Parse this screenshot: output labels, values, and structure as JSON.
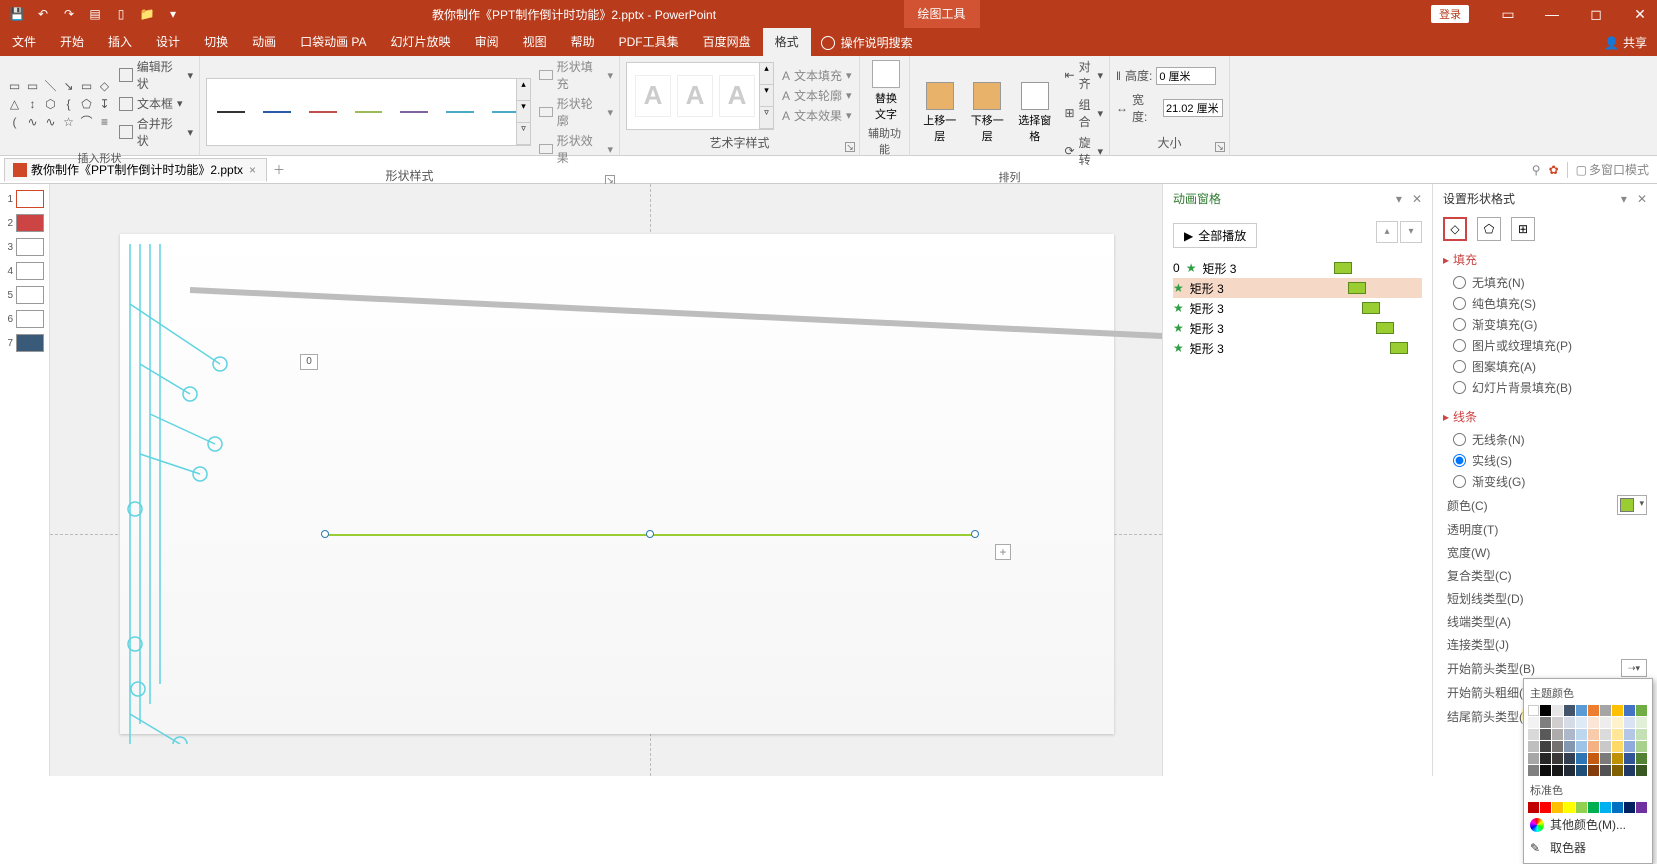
{
  "titlebar": {
    "doc_title": "教你制作《PPT制作倒计时功能》2.pptx - PowerPoint",
    "context_tab": "绘图工具",
    "login": "登录",
    "share": "共享"
  },
  "tabs": {
    "file": "文件",
    "home": "开始",
    "insert": "插入",
    "design": "设计",
    "transition": "切换",
    "animation": "动画",
    "pocket": "口袋动画 PA",
    "slideshow": "幻灯片放映",
    "review": "审阅",
    "view": "视图",
    "help": "帮助",
    "pdf": "PDF工具集",
    "baidu": "百度网盘",
    "format": "格式",
    "tell": "操作说明搜索"
  },
  "ribbon": {
    "insert_shapes": {
      "label": "插入形状",
      "edit_shape": "编辑形状",
      "text_box": "文本框",
      "merge_shape": "合并形状"
    },
    "shape_styles": {
      "label": "形状样式",
      "fill": "形状填充",
      "outline": "形状轮廓",
      "effects": "形状效果"
    },
    "wordart": {
      "label": "艺术字样式",
      "text_fill": "文本填充",
      "text_outline": "文本轮廓",
      "text_effects": "文本效果"
    },
    "accessibility": {
      "label": "辅助功能",
      "alt_text": "替换\n文字"
    },
    "arrange": {
      "label": "排列",
      "bring_forward": "上移一层",
      "send_backward": "下移一层",
      "selection_pane": "选择窗格",
      "align": "对齐",
      "group": "组合",
      "rotate": "旋转"
    },
    "size": {
      "label": "大小",
      "height": "高度:",
      "width": "宽度:",
      "h_val": "0 厘米",
      "w_val": "21.02 厘米"
    }
  },
  "doctab": {
    "name": "教你制作《PPT制作倒计时功能》2.pptx",
    "multiwin": "多窗口模式"
  },
  "canvas": {
    "counter": "0"
  },
  "anim_pane": {
    "title": "动画窗格",
    "play_all": "全部播放",
    "items": [
      {
        "idx": "0",
        "name": "矩形 3"
      },
      {
        "idx": "",
        "name": "矩形 3"
      },
      {
        "idx": "",
        "name": "矩形 3"
      },
      {
        "idx": "",
        "name": "矩形 3"
      },
      {
        "idx": "",
        "name": "矩形 3"
      }
    ]
  },
  "fmt_pane": {
    "title": "设置形状格式",
    "fill": {
      "header": "填充",
      "no_fill": "无填充(N)",
      "solid": "纯色填充(S)",
      "gradient": "渐变填充(G)",
      "picture": "图片或纹理填充(P)",
      "pattern": "图案填充(A)",
      "slidebg": "幻灯片背景填充(B)"
    },
    "line": {
      "header": "线条",
      "no_line": "无线条(N)",
      "solid": "实线(S)",
      "gradient": "渐变线(G)",
      "color": "颜色(C)",
      "transparency": "透明度(T)",
      "width": "宽度(W)",
      "compound": "复合类型(C)",
      "dash": "短划线类型(D)",
      "cap": "线端类型(A)",
      "join": "连接类型(J)",
      "begin_type": "开始箭头类型(B)",
      "begin_size": "开始箭头粗细(S)",
      "end_type": "结尾箭头类型(E)"
    }
  },
  "flyout": {
    "theme": "主题颜色",
    "standard": "标准色",
    "more": "其他颜色(M)...",
    "eyedrop": "取色器"
  }
}
